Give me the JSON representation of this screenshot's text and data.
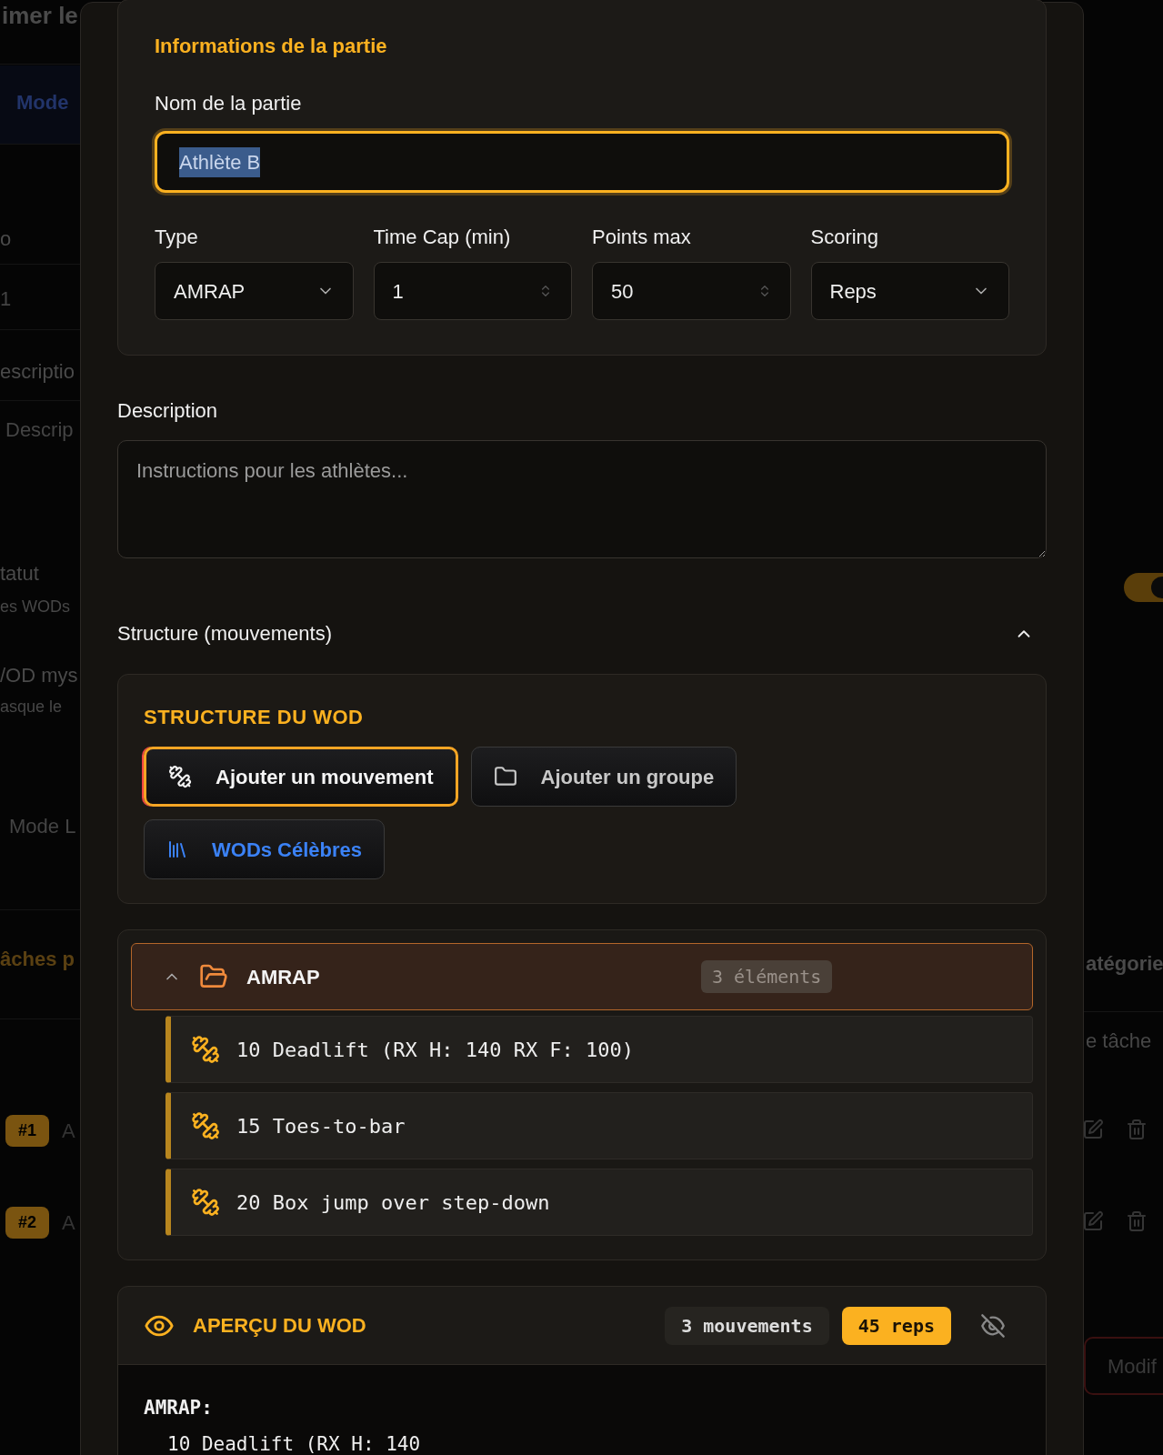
{
  "background": {
    "left": [
      {
        "text": "imer le",
        "kind": "title"
      },
      {
        "text": "Mode",
        "kind": "tab"
      },
      {
        "text": "o",
        "kind": "label"
      },
      {
        "text": "1",
        "kind": "value"
      },
      {
        "text": "escriptio",
        "kind": "label"
      },
      {
        "text": "Descrip",
        "kind": "placeholder"
      },
      {
        "text": "tatut",
        "kind": "label"
      },
      {
        "text": "es WODs",
        "kind": "hint"
      },
      {
        "text": "/OD mys",
        "kind": "label"
      },
      {
        "text": "asque le",
        "kind": "hint"
      },
      {
        "text": "Mode L",
        "kind": "value"
      },
      {
        "text": "âches p",
        "kind": "heading"
      },
      {
        "text": "#1",
        "kind": "badge",
        "after": "A"
      },
      {
        "text": "#2",
        "kind": "badge",
        "after": "A"
      }
    ],
    "toggle": {
      "on": true
    },
    "right": [
      {
        "text": "atégorie",
        "kind": "label"
      },
      {
        "text": "e tâche",
        "kind": "placeholder"
      }
    ],
    "action_button": "Modif"
  },
  "modal": {
    "info": {
      "title": "Informations de la partie",
      "name_field": {
        "label": "Nom de la partie",
        "value": "Athlète B",
        "focused": true,
        "text_selected": true
      },
      "fields": [
        {
          "label": "Type",
          "kind": "select",
          "value": "AMRAP"
        },
        {
          "label": "Time Cap (min)",
          "kind": "number",
          "value": "1"
        },
        {
          "label": "Points max",
          "kind": "number",
          "value": "50"
        },
        {
          "label": "Scoring",
          "kind": "select",
          "value": "Reps"
        }
      ]
    },
    "description": {
      "label": "Description",
      "placeholder": "Instructions pour les athlètes..."
    },
    "structure": {
      "title": "Structure (mouvements)",
      "expanded": true,
      "builder_title": "STRUCTURE DU WOD",
      "buttons": [
        {
          "label": "Ajouter un mouvement",
          "kind": "movement",
          "selected": true
        },
        {
          "label": "Ajouter un groupe",
          "kind": "group",
          "selected": false
        },
        {
          "label": "WODs Célèbres",
          "kind": "library",
          "selected": false
        }
      ],
      "groups": [
        {
          "name": "AMRAP",
          "count": "3 éléments",
          "expanded": true,
          "children": [
            {
              "label": "10 Deadlift (RX H: 140 RX F: 100)"
            },
            {
              "label": "15 Toes-to-bar"
            },
            {
              "label": "20 Box jump over step-down"
            }
          ]
        }
      ]
    },
    "preview": {
      "title": "APERÇU DU WOD",
      "movements": "3 mouvements",
      "reps": "45 reps",
      "lines": [
        {
          "text": "AMRAP:",
          "kind": "header"
        },
        {
          "text": "10 Deadlift (RX H: 140",
          "kind": "item"
        }
      ]
    }
  }
}
